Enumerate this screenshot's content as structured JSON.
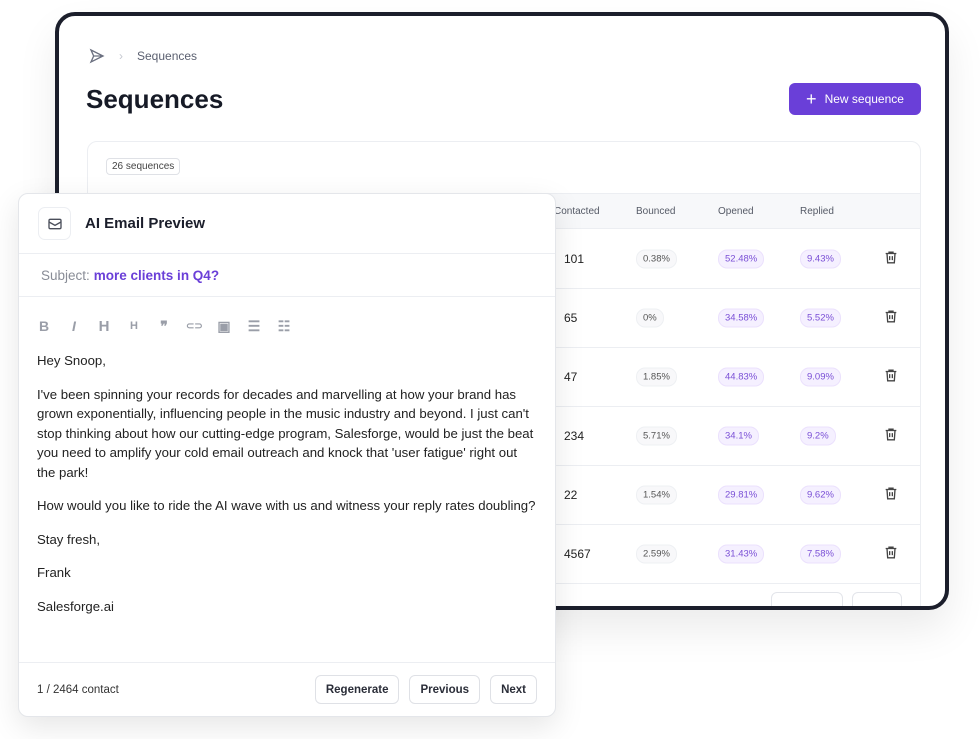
{
  "breadcrumb": {
    "icon": "send-icon",
    "current": "Sequences"
  },
  "page_title": "Sequences",
  "new_button": "New sequence",
  "count_badge": "26 sequences",
  "columns": [
    "Contacted",
    "Bounced",
    "Opened",
    "Replied"
  ],
  "rows": [
    {
      "contacted": "101",
      "bounced": "0.38%",
      "opened": "52.48%",
      "replied": "9.43%"
    },
    {
      "contacted": "65",
      "bounced": "0%",
      "opened": "34.58%",
      "replied": "5.52%"
    },
    {
      "contacted": "47",
      "bounced": "1.85%",
      "opened": "44.83%",
      "replied": "9.09%"
    },
    {
      "contacted": "234",
      "bounced": "5.71%",
      "opened": "34.1%",
      "replied": "9.2%"
    },
    {
      "contacted": "22",
      "bounced": "1.54%",
      "opened": "29.81%",
      "replied": "9.62%"
    },
    {
      "contacted": "4567",
      "bounced": "2.59%",
      "opened": "31.43%",
      "replied": "7.58%"
    }
  ],
  "colors": {
    "accent": "#6a3fd8",
    "frame": "#1b1e2b"
  },
  "modal": {
    "title": "AI Email Preview",
    "subject_label": "Subject:",
    "subject": "more clients in Q4?",
    "toolbar": [
      "B",
      "I",
      "H",
      "H",
      "❞",
      "⊂⊃",
      "▣",
      "☰",
      "☷"
    ],
    "body": [
      "Hey Snoop,",
      "I've been spinning your records for decades and marvelling at how your brand has grown exponentially, influencing people in the music industry and beyond. I just can't stop thinking about how our cutting-edge program, Salesforge, would be just the beat you need to amplify your cold email outreach and knock that 'user fatigue' right out the park!",
      "How would you like to ride the AI wave with us and witness your reply rates doubling?",
      "Stay fresh,",
      "Frank",
      "Salesforge.ai"
    ],
    "contact_count": "1 / 2464 contact",
    "regenerate": "Regenerate",
    "previous": "Previous",
    "next": "Next"
  }
}
